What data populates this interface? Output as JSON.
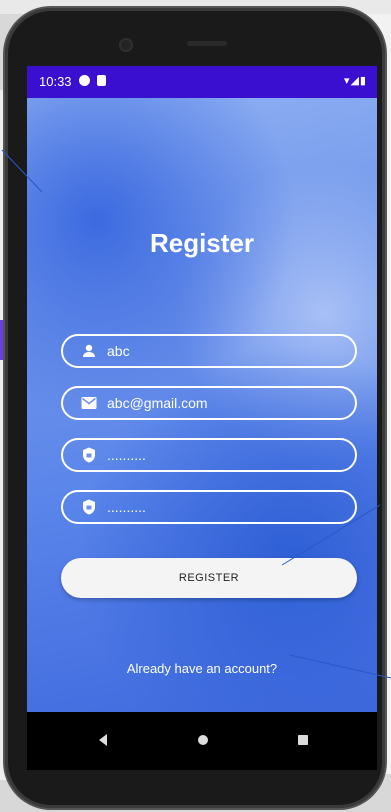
{
  "status": {
    "time": "10:33",
    "right_indicators": "▾◢▮"
  },
  "screen": {
    "title": "Register",
    "fields": [
      {
        "icon": "person-icon",
        "value": "abc",
        "type": "text"
      },
      {
        "icon": "mail-icon",
        "value": "abc@gmail.com",
        "type": "email"
      },
      {
        "icon": "shield-icon",
        "value": "..........",
        "type": "password"
      },
      {
        "icon": "shield-icon",
        "value": "..........",
        "type": "password"
      }
    ],
    "register_label": "REGISTER",
    "login_link": "Already have an account?"
  },
  "nav": {
    "back": "back-icon",
    "home": "home-icon",
    "recent": "recent-apps-icon"
  },
  "colors": {
    "status_bar": "#3a0fd0",
    "accent_blue": "#5a85ea"
  }
}
